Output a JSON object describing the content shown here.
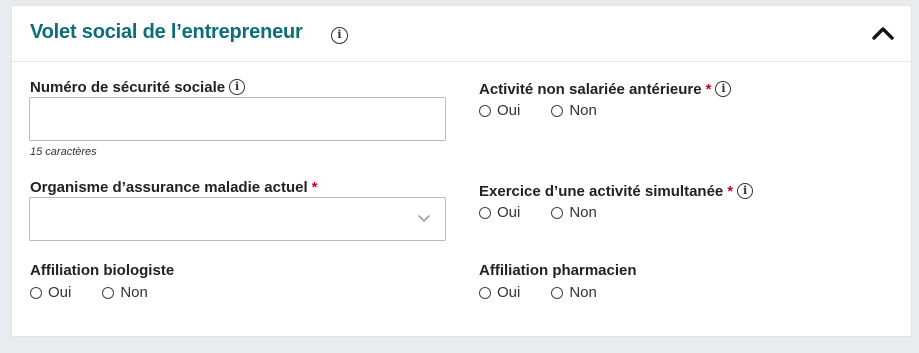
{
  "section": {
    "title": "Volet social de l’entrepreneur"
  },
  "fields": {
    "nir": {
      "label": "Numéro de sécurité sociale",
      "value": "",
      "hint": "15 caractères"
    },
    "organisme": {
      "label": "Organisme d’assurance maladie actuel",
      "required_mark": "*",
      "selected": ""
    },
    "affiliation_bio": {
      "label": "Affiliation biologiste",
      "options": [
        "Oui",
        "Non"
      ]
    },
    "activite_anterieure": {
      "label": "Activité non salariée antérieure",
      "required_mark": "*",
      "options": [
        "Oui",
        "Non"
      ]
    },
    "activite_simultanee": {
      "label": "Exercice d’une activité simultanée",
      "required_mark": "*",
      "options": [
        "Oui",
        "Non"
      ]
    },
    "affiliation_pharma": {
      "label": "Affiliation pharmacien",
      "options": [
        "Oui",
        "Non"
      ]
    }
  },
  "icons": {
    "info": "info-icon",
    "collapse": "chevron-up-icon",
    "dropdown": "chevron-down-icon"
  },
  "colors": {
    "title": "#0d6e7a",
    "required": "#d0021b"
  }
}
